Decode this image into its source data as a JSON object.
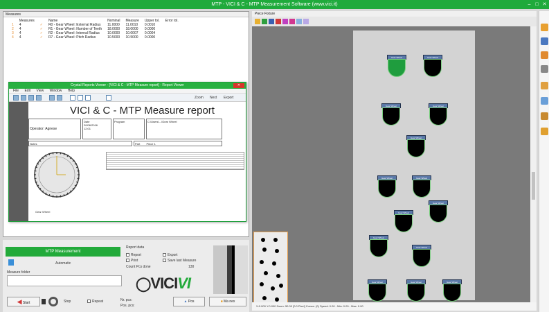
{
  "window": {
    "title": "MTP - VICI & C - MTP Measurement Software (www.vici.it)"
  },
  "left_panel": {
    "title": "Measures",
    "columns": [
      "",
      "Measures",
      "",
      "Name",
      "Nominal",
      "Measure",
      "Upper tol.",
      "Error tol."
    ],
    "rows": [
      {
        "n": "1",
        "m": "4",
        "t": "✓",
        "name": "R0 - Gear Wheel: External Radius",
        "nominal": "11.0000",
        "measure": "11.0010",
        "tol": "0.0010",
        "err": ""
      },
      {
        "n": "2",
        "m": "4",
        "t": "✓",
        "name": "R1 - Gear Wheel: Number of Teeth",
        "nominal": "18.0000",
        "measure": "18.0000",
        "tol": "0.0000",
        "err": ""
      },
      {
        "n": "3",
        "m": "4",
        "t": "✓",
        "name": "R2 - Gear Wheel: Internal Radius",
        "nominal": "10.0000",
        "measure": "10.0007",
        "tol": "0.0004",
        "err": ""
      },
      {
        "n": "4",
        "m": "4",
        "t": "✓",
        "name": "R7 - Gear Wheel: Pitch Radius",
        "nominal": "10.5000",
        "measure": "10.5000",
        "tol": "0.0000",
        "err": ""
      }
    ],
    "row_colors": [
      "#e58a2a",
      "#e58a2a",
      "#e58a2a",
      "#e58a2a"
    ]
  },
  "report": {
    "title": "Crystal Reports Viewer - [VICI & C - MTP Measure report] - Report Viewer",
    "menu": [
      "File",
      "Edit",
      "View",
      "Window",
      "Help"
    ],
    "heading": "VICI & C - MTP Measure report",
    "operator": "Operator: Agnese",
    "date_label": "Date",
    "date": "20/06/2016",
    "time": "12:01",
    "program_label": "Program",
    "program": "C:\\Users\\...\\Gear Wheel",
    "part_label": "Part",
    "part": "Piece 1",
    "notes_label": "Notes",
    "page_label": "Page 1 of 1",
    "toolbar_right": [
      "Zoom",
      "Next",
      "Export"
    ],
    "gauge_label": "Gear Wheel"
  },
  "bottom": {
    "green_button": "MTP Measurement",
    "mode_label": "Automatic",
    "search_label": "Measure folder",
    "start_label": "Start",
    "stop_label": "Stop",
    "repeat_label": "Repeat",
    "options_title": "Report data",
    "opt_report": "Report",
    "opt_print": "Print",
    "opt_export": "Export",
    "opt_save": "Save last Measure",
    "count_label": "Count Pcs done",
    "count_value": "130",
    "nr_label": "Nr. pcs:",
    "pos_label": "Pos. pcs:",
    "tab1": "Pos",
    "tab2": "Ma nex"
  },
  "logo": {
    "main": "VICI",
    "accent": "VI"
  },
  "right_panel": {
    "title": "Piece Fixture",
    "status": "X:0.000 Y:0.000  Zoom: 50.00 [0.0 Pixel]  Cursor: (0)  Speed: 0.00 -   Min: 0.00 - Max: 0.00",
    "wells": [
      {
        "label": "Gear Wheel",
        "green": true
      },
      {
        "label": "Gear Wheel",
        "green": false
      },
      {
        "label": "Gear Wheel",
        "green": false
      },
      {
        "label": "Gear Wheel",
        "green": false
      },
      {
        "label": "Gear Wheel",
        "green": false
      },
      {
        "label": "Gear Wheel",
        "green": false
      },
      {
        "label": "Gear Wheel",
        "green": false
      },
      {
        "label": "Gear Wheel",
        "green": false
      },
      {
        "label": "Gear Wheel",
        "green": false
      },
      {
        "label": "Gear Wheel",
        "green": false
      },
      {
        "label": "Gear Wheel",
        "green": false
      },
      {
        "label": "Gear Wheel",
        "green": false
      },
      {
        "label": "Gear Wheel",
        "green": false
      },
      {
        "label": "Gear Wheel",
        "green": false
      }
    ]
  },
  "colors": {
    "accent": "#22aa3a",
    "title_green": "#1faa3c",
    "well_cap": "#5a78a8"
  }
}
